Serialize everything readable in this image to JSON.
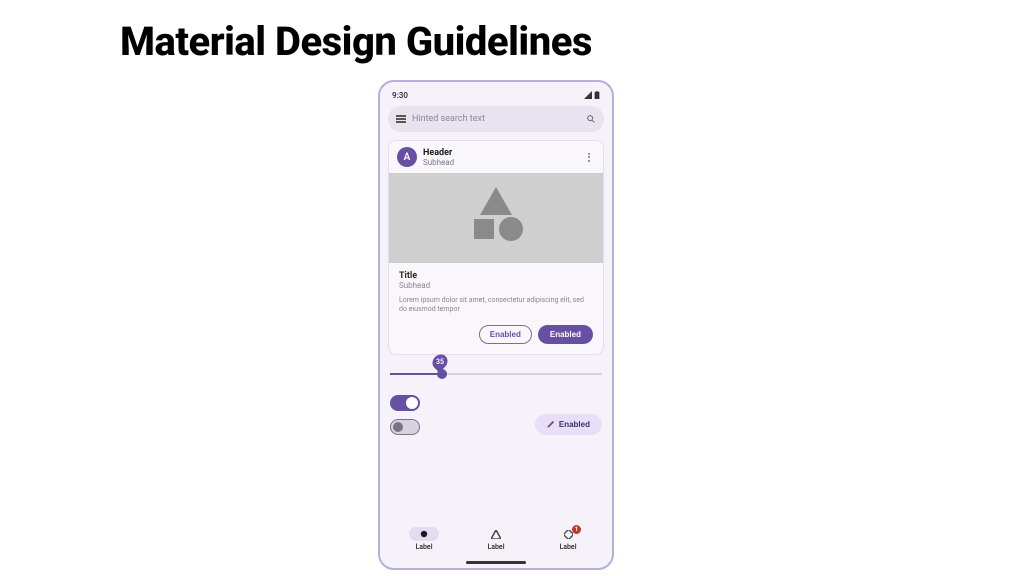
{
  "page": {
    "title": "Material Design Guidelines"
  },
  "status": {
    "time": "9:30"
  },
  "search": {
    "placeholder": "Hinted search text"
  },
  "card": {
    "avatar_initial": "A",
    "header": "Header",
    "subhead": "Subhead",
    "title": "Title",
    "title_subhead": "Subhead",
    "description": "Lorem ipsum dolor sit amet, consectetur adipiscing elit, sed do eiusmod tempor",
    "button_outlined": "Enabled",
    "button_filled": "Enabled"
  },
  "slider": {
    "value_label": "35"
  },
  "tonal_button": {
    "label": "Enabled"
  },
  "nav": {
    "items": [
      {
        "label": "Label"
      },
      {
        "label": "Label"
      },
      {
        "label": "Label"
      }
    ],
    "badge_count": "1"
  },
  "colors": {
    "primary": "#6750a4",
    "surface": "#f5f3f9",
    "secondary_container": "#e8def8"
  }
}
